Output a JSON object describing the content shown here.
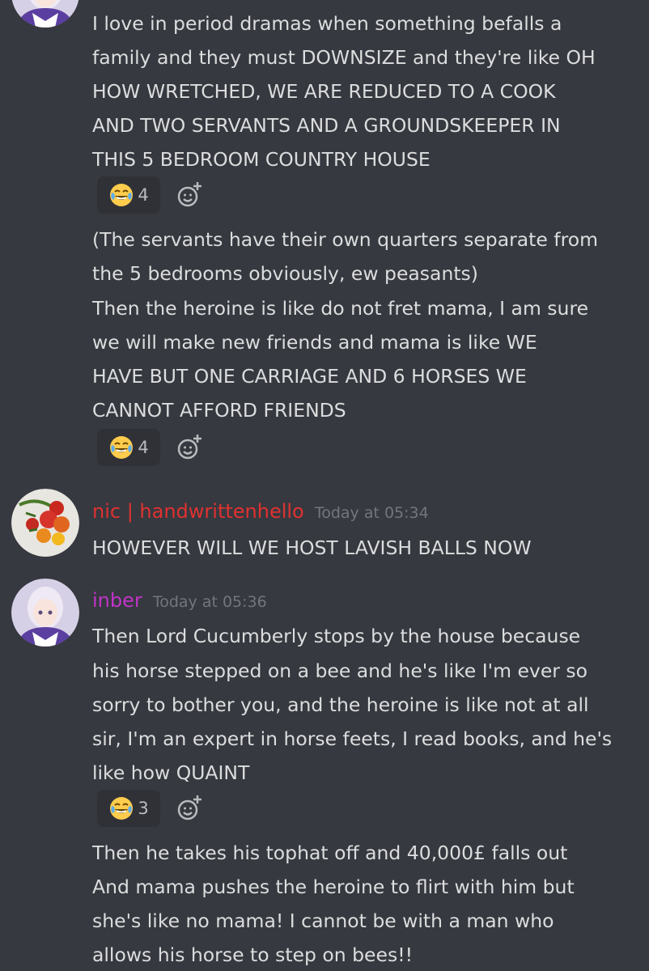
{
  "messages": [
    {
      "lines": [
        "I love in period dramas when something befalls a",
        "family and they must DOWNSIZE and they're like OH",
        "HOW WRETCHED, WE ARE REDUCED TO A COOK",
        "AND TWO SERVANTS AND A GROUNDSKEEPER IN",
        "THIS 5 BEDROOM COUNTRY HOUSE"
      ],
      "reaction": {
        "emoji": "joy-emoji",
        "count": "4"
      }
    },
    {
      "lines": [
        "(The servants have their own quarters separate from",
        "the 5 bedrooms obviously, ew peasants)",
        "Then the heroine is like do not fret mama, I am sure",
        "we will make new friends and mama is like WE",
        "HAVE BUT ONE CARRIAGE AND 6 HORSES WE",
        "CANNOT AFFORD FRIENDS"
      ],
      "reaction": {
        "emoji": "joy-emoji",
        "count": "4"
      }
    },
    {
      "author": "nic | handwrittenhello",
      "author_color": "#e03131",
      "timestamp": "Today at 05:34",
      "lines": [
        "HOWEVER WILL WE HOST LAVISH BALLS NOW"
      ]
    },
    {
      "author": "inber",
      "author_color": "#c034c8",
      "timestamp": "Today at 05:36",
      "lines": [
        "Then Lord Cucumberly stops by the house because",
        "his horse stepped on a bee and he's like I'm ever so",
        "sorry to bother you, and the heroine is like not at all",
        "sir, I'm an expert in horse feets, I read books, and he's",
        "like how QUAINT"
      ],
      "reaction": {
        "emoji": "joy-emoji",
        "count": "3"
      }
    },
    {
      "lines": [
        "Then he takes his tophat off and 40,000£ falls out",
        "And mama pushes the heroine to flirt with him but",
        "she's like no mama! I cannot be with a man who",
        "allows his horse to step on bees!!"
      ]
    }
  ],
  "icons": {
    "add_reaction": "add-reaction-icon",
    "avatar_inber": "anime-avatar",
    "avatar_nic": "tomato-avatar"
  },
  "colors": {
    "background": "#36393f",
    "text": "#dcddde",
    "timestamp": "#72767d",
    "reaction_bg": "#2f3136"
  }
}
